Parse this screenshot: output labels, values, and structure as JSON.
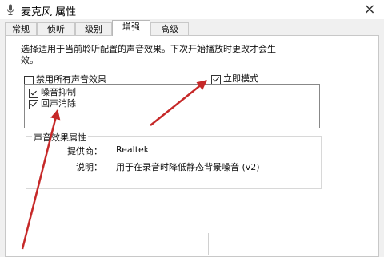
{
  "window": {
    "title": "麦克风 属性",
    "close_symbol": "×"
  },
  "tabs": [
    {
      "label": "常规",
      "active": false
    },
    {
      "label": "侦听",
      "active": false
    },
    {
      "label": "级别",
      "active": false
    },
    {
      "label": "增强",
      "active": true
    },
    {
      "label": "高级",
      "active": false
    }
  ],
  "enhancements": {
    "description_line1": "选择适用于当前聆听配置的声音效果。下次开始播放时更改才会生",
    "description_line2": "效。",
    "disable_all": {
      "label": "禁用所有声音效果",
      "checked": false
    },
    "immediate_mode": {
      "label": "立即模式",
      "checked": true
    },
    "items": [
      {
        "label": "噪音抑制",
        "checked": true
      },
      {
        "label": "回声消除",
        "checked": true
      }
    ]
  },
  "properties": {
    "group_title": "声音效果属性",
    "provider_label": "提供商：",
    "provider_value": "Realtek",
    "description_label": "说明：",
    "description_value": "用于在录音时降低静态背景噪音 (v2)"
  },
  "colors": {
    "annotation_arrow": "#c62828"
  }
}
